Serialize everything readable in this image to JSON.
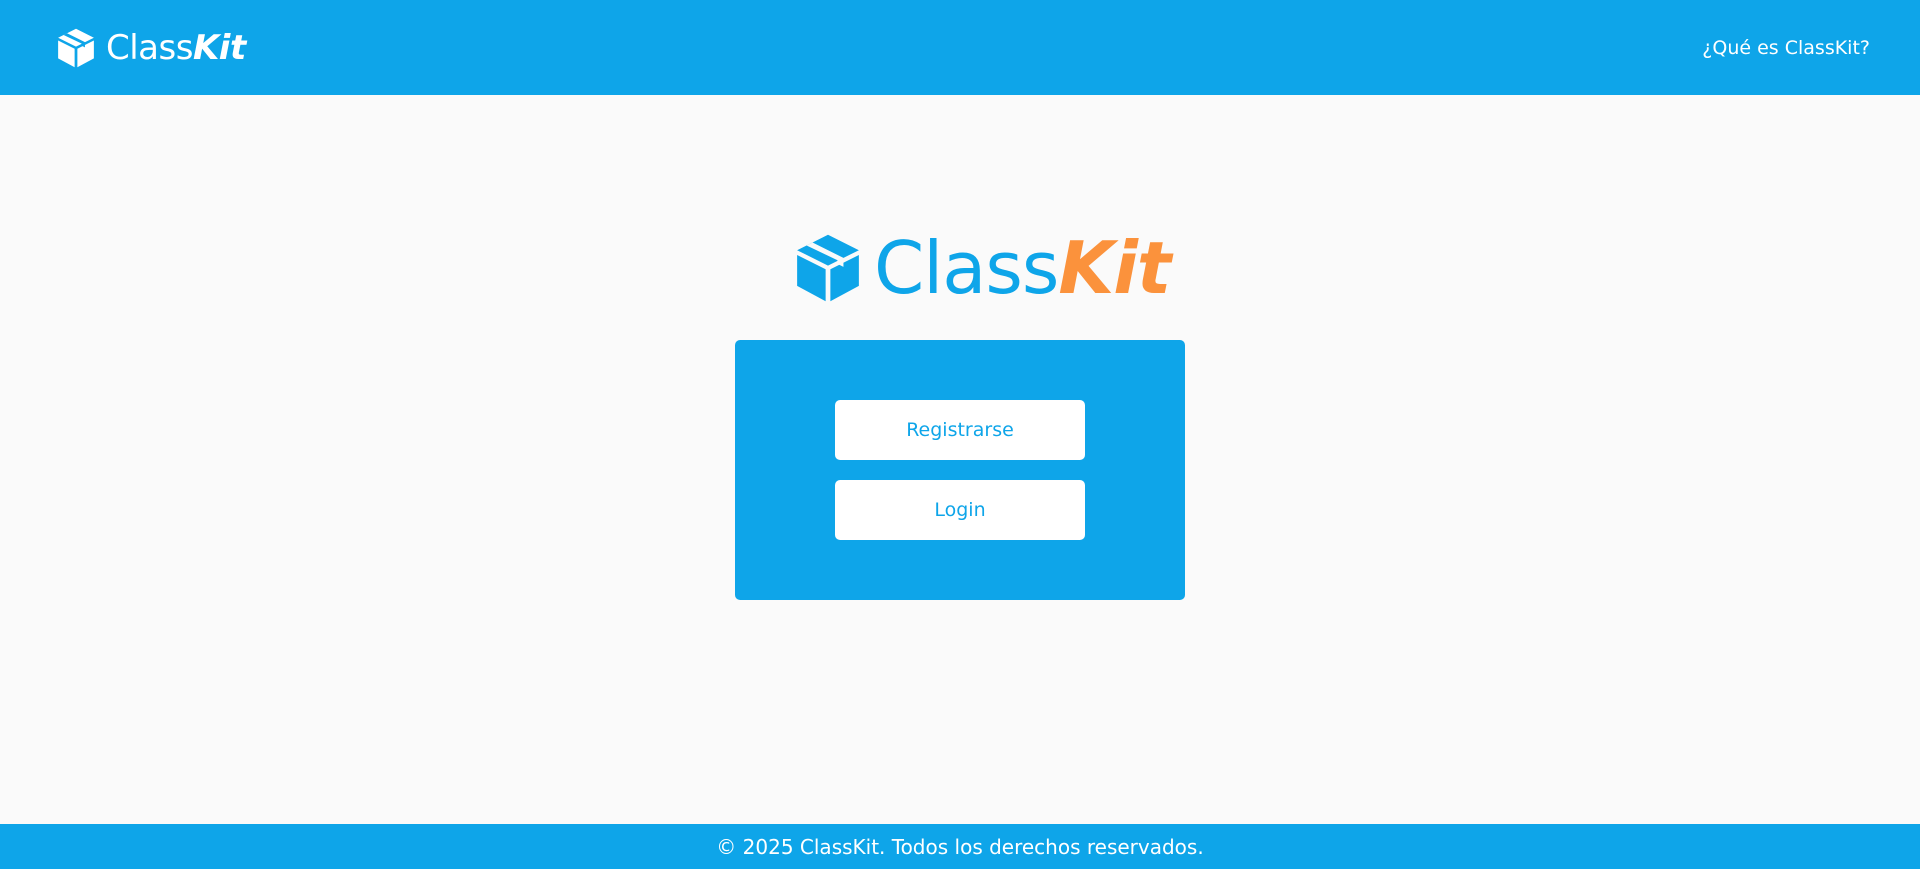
{
  "colors": {
    "primary": "#0ea5e9",
    "accent": "#fb923c",
    "background": "#fafafa",
    "white": "#ffffff"
  },
  "header": {
    "brand": {
      "icon": "box-icon",
      "name_part1": "Class",
      "name_part2": "Kit"
    },
    "nav_link": "¿Qué es ClassKit?"
  },
  "hero": {
    "icon": "box-icon",
    "name_part1": "Class",
    "name_part2": "Kit"
  },
  "auth_card": {
    "register_label": "Registrarse",
    "login_label": "Login"
  },
  "footer": {
    "text": "© 2025 ClassKit. Todos los derechos reservados."
  }
}
